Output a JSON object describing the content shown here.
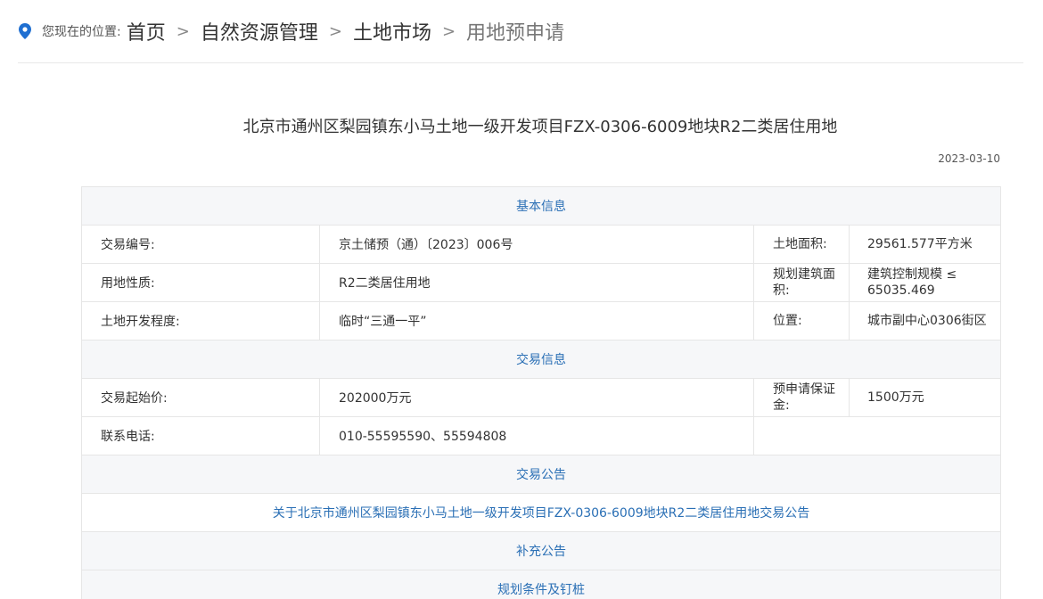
{
  "breadcrumb": {
    "prefix": "您现在的位置:",
    "items": [
      "首页",
      "自然资源管理",
      "土地市场",
      "用地预申请"
    ],
    "separator": ">"
  },
  "notice": {
    "title": "北京市通州区梨园镇东小马土地一级开发项目FZX-0306-6009地块R2二类居住用地",
    "date": "2023-03-10"
  },
  "table": {
    "basic_header": "基本信息",
    "trade_no_label": "交易编号:",
    "trade_no_value": "京土储预（通）〔2023〕006号",
    "land_area_label": "土地面积:",
    "land_area_value": "29561.577平方米",
    "land_use_label": "用地性质:",
    "land_use_value": "R2二类居住用地",
    "plan_area_label": "规划建筑面积:",
    "plan_area_value": "建筑控制规模 ≤ 65035.469",
    "dev_level_label": "土地开发程度:",
    "dev_level_value": "临时“三通一平”",
    "location_label": "位置:",
    "location_value": "城市副中心0306街区",
    "trade_header": "交易信息",
    "start_price_label": "交易起始价:",
    "start_price_value": "202000万元",
    "deposit_label": "预申请保证金:",
    "deposit_value": "1500万元",
    "phone_label": "联系电话:",
    "phone_value": "010-55595590、55594808",
    "announce_header": "交易公告",
    "announce_link": "关于北京市通州区梨园镇东小马土地一级开发项目FZX-0306-6009地块R2二类居住用地交易公告",
    "supplement_header": "补充公告",
    "planning_header": "规划条件及钉桩"
  },
  "colors": {
    "link_blue": "#2a6fb5",
    "pin_blue": "#1f6fd1",
    "section_bg": "#f6f7f9"
  },
  "icons": {
    "location": "map-pin-icon"
  }
}
